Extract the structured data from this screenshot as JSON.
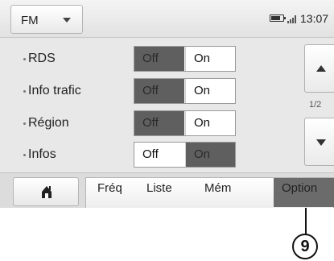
{
  "topbar": {
    "band_value": "FM",
    "band_icon": "chevron-down-icon",
    "status_icons": [
      "battery-icon",
      "signal-icon"
    ],
    "time": "13:07"
  },
  "settings": [
    {
      "label": "RDS",
      "off_label": "Off",
      "on_label": "On",
      "value": "Off"
    },
    {
      "label": "Info trafic",
      "off_label": "Off",
      "on_label": "On",
      "value": "Off"
    },
    {
      "label": "Région",
      "off_label": "Off",
      "on_label": "On",
      "value": "Off"
    },
    {
      "label": "Infos",
      "off_label": "Off",
      "on_label": "On",
      "value": "On"
    }
  ],
  "pager": {
    "indicator": "1/2",
    "up_icon": "arrow-up-icon",
    "down_icon": "arrow-down-icon"
  },
  "bottombar": {
    "home_icon": "home-icon",
    "tabs": [
      {
        "label": "Fréq",
        "active": false
      },
      {
        "label": "Liste",
        "active": false
      },
      {
        "label": "Mém",
        "active": false
      },
      {
        "label": "Option",
        "active": true
      }
    ]
  },
  "callout": {
    "number": "9"
  },
  "colors": {
    "active_segment": "#5f5f5f",
    "active_tab": "#6b6b6b",
    "screen_bg": "#e8e8e8"
  }
}
